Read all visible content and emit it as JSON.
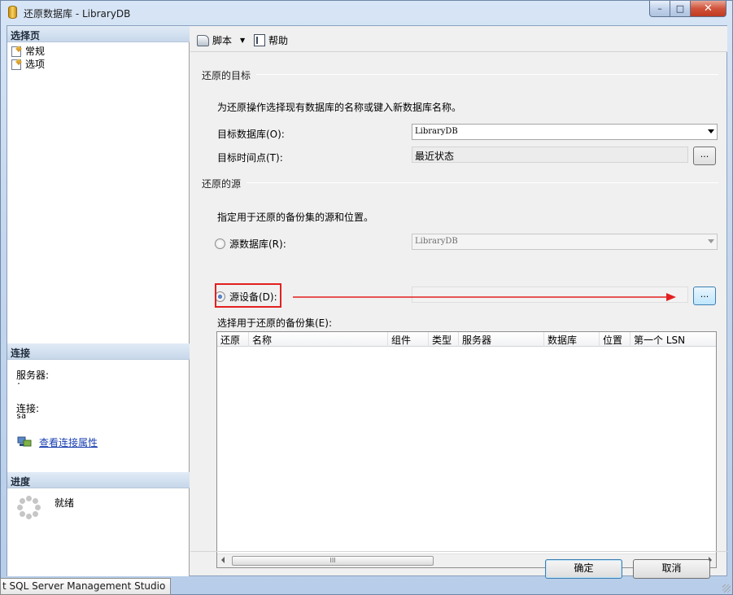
{
  "window": {
    "title": "还原数据库 - LibraryDB",
    "minimize": "–",
    "maximize": "□",
    "close": "✕"
  },
  "left": {
    "select_page_header": "选择页",
    "pages": [
      {
        "label": "常规",
        "icon": "page-icon"
      },
      {
        "label": "选项",
        "icon": "page-icon"
      }
    ],
    "connection_header": "连接",
    "server_label": "服务器:",
    "server_value": ".",
    "connection_label": "连接:",
    "connection_value": "sa",
    "view_connection_link": "查看连接属性",
    "progress_header": "进度",
    "progress_status": "就绪"
  },
  "toolbar": {
    "script_label": "脚本",
    "help_label": "帮助"
  },
  "target": {
    "group_title": "还原的目标",
    "description": "为还原操作选择现有数据库的名称或键入新数据库名称。",
    "target_db_label": "目标数据库(O):",
    "target_db_value": "LibraryDB",
    "target_time_label": "目标时间点(T):",
    "target_time_value": "最近状态",
    "ellipsis": "..."
  },
  "source": {
    "group_title": "还原的源",
    "description": "指定用于还原的备份集的源和位置。",
    "source_db_label": "源数据库(R):",
    "source_db_value": "LibraryDB",
    "source_device_label": "源设备(D):",
    "source_device_value": "",
    "ellipsis": "..."
  },
  "backup_sets": {
    "label": "选择用于还原的备份集(E):",
    "columns": [
      "还原",
      "名称",
      "组件",
      "类型",
      "服务器",
      "数据库",
      "位置",
      "第一个 LSN"
    ],
    "rows": [],
    "scroll_thumb": "III"
  },
  "buttons": {
    "ok": "确定",
    "cancel": "取消"
  },
  "taskbar": {
    "tooltip": "t SQL Server Management Studio"
  },
  "colors": {
    "annotation_red": "#e2201f",
    "link_blue": "#1a3fb0"
  }
}
